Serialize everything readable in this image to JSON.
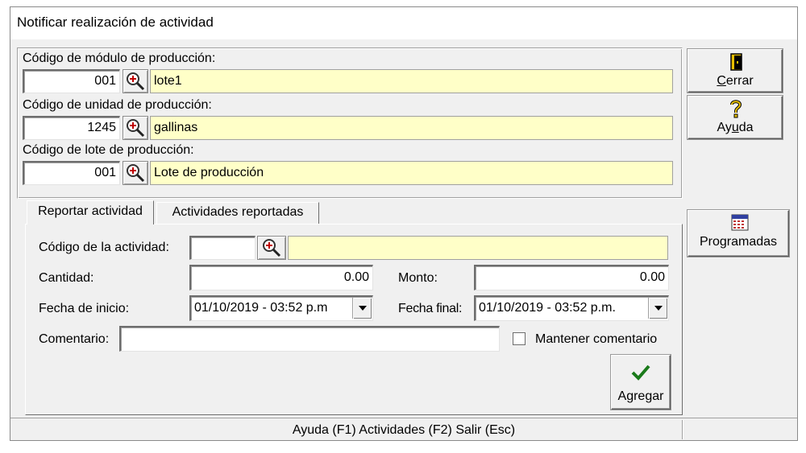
{
  "window": {
    "title": "Notificar realización de actividad"
  },
  "header_fields": {
    "modulo": {
      "label": "Código de módulo de producción:",
      "code": "001",
      "name": "lote1"
    },
    "unidad": {
      "label": "Código de unidad de producción:",
      "code": "1245",
      "name": "gallinas"
    },
    "lote": {
      "label": "Código de lote de producción:",
      "code": "001",
      "name": "Lote de producción"
    }
  },
  "side_buttons": {
    "cerrar": {
      "label_pre": "",
      "label_u": "C",
      "label_post": "errar",
      "icon": "door-exit-icon"
    },
    "ayuda": {
      "label_pre": "Ay",
      "label_u": "u",
      "label_post": "da",
      "icon": "help-question-icon"
    },
    "programadas": {
      "label": "Programadas",
      "icon": "calendar-icon"
    }
  },
  "tabs": [
    {
      "label": "Reportar actividad",
      "active": true
    },
    {
      "label": "Actividades reportadas",
      "active": false
    }
  ],
  "form": {
    "actividad": {
      "label": "Código de la actividad:",
      "code": "",
      "name": ""
    },
    "cantidad": {
      "label": "Cantidad:",
      "value": "0.00"
    },
    "monto": {
      "label": "Monto:",
      "value": "0.00"
    },
    "fecha_inicio": {
      "label": "Fecha de inicio:",
      "value": "01/10/2019 - 03:52 p.m"
    },
    "fecha_final": {
      "label": "Fecha final:",
      "value": "01/10/2019 - 03:52 p.m."
    },
    "comentario": {
      "label": "Comentario:",
      "value": ""
    },
    "mantener": {
      "label": "Mantener comentario",
      "checked": false
    },
    "agregar": {
      "label": "Agregar",
      "icon": "checkmark-icon"
    }
  },
  "statusbar": {
    "text": "Ayuda (F1)  Actividades (F2)  Salir (Esc)"
  },
  "colors": {
    "lookup_yellow": "#ffffc8",
    "window_bg": "#f0f0f0",
    "check_green": "#1a7a1a"
  }
}
